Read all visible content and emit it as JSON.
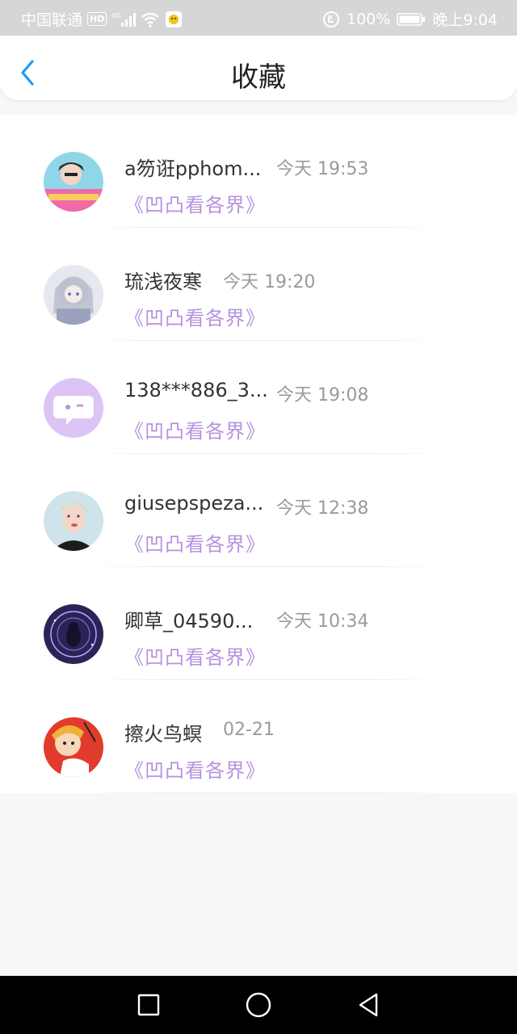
{
  "status_bar": {
    "carrier": "中国联通",
    "hd": "HD",
    "network": "4G",
    "battery_percent": "100%",
    "time": "晚上9:04"
  },
  "header": {
    "title": "收藏",
    "back_icon": "chevron-left-icon"
  },
  "favorites": [
    {
      "name": "a笏诳pphom...",
      "time": "今天 19:53",
      "work": "《凹凸看各界》"
    },
    {
      "name": "琉浅夜寒",
      "time": "今天 19:20",
      "work": "《凹凸看各界》"
    },
    {
      "name": "138***886_3...",
      "time": "今天 19:08",
      "work": "《凹凸看各界》"
    },
    {
      "name": "giusepspeza...",
      "time": "今天 12:38",
      "work": "《凹凸看各界》"
    },
    {
      "name": "卿草_04590...",
      "time": "今天 10:34",
      "work": "《凹凸看各界》"
    },
    {
      "name": "擦火鸟螟",
      "time": "02-21",
      "work": "《凹凸看各界》"
    }
  ],
  "nav_bar": {
    "recents_icon": "square-icon",
    "home_icon": "circle-icon",
    "back_icon": "triangle-back-icon"
  },
  "colors": {
    "accent": "#1e9cf0",
    "work_title": "#b592de",
    "status_bar": "#d6d6d6"
  }
}
